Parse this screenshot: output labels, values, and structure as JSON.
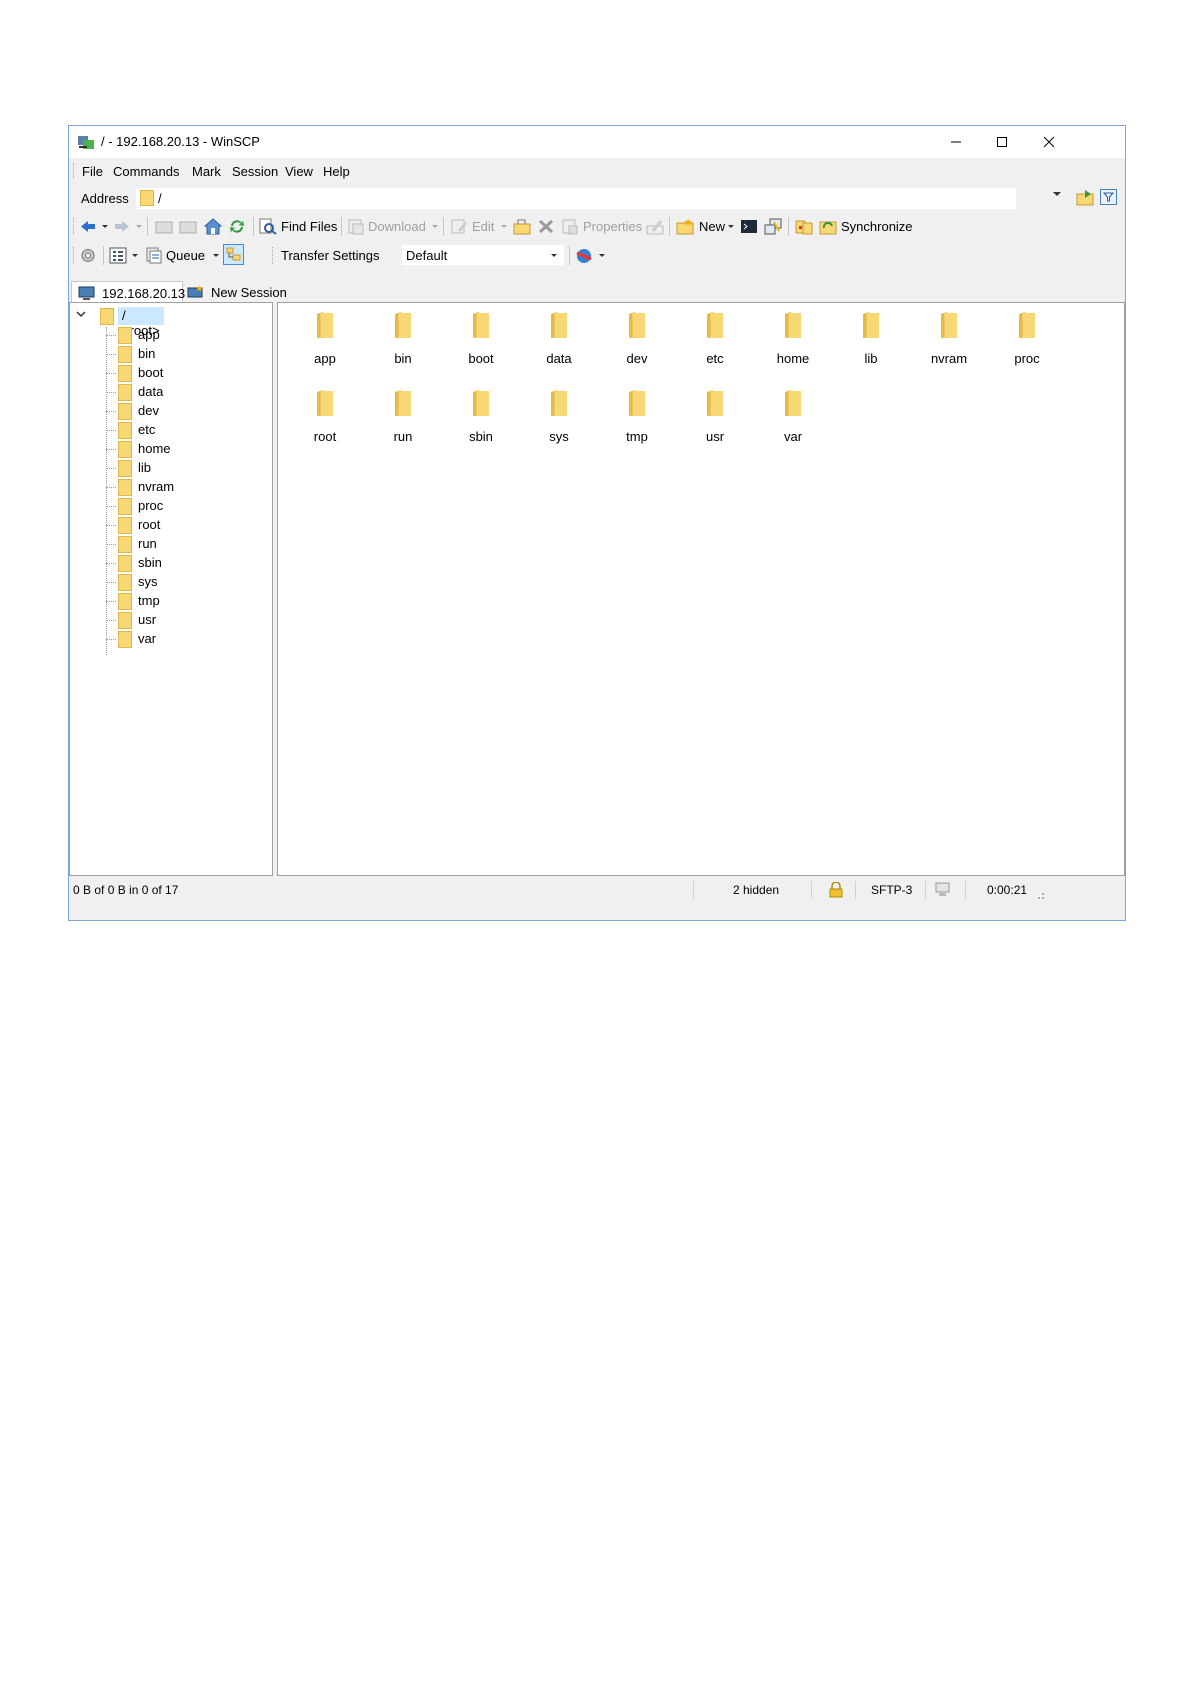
{
  "window": {
    "title": "/ - 192.168.20.13 - WinSCP"
  },
  "menu": [
    "File",
    "Commands",
    "Mark",
    "Session",
    "View",
    "Help"
  ],
  "address": {
    "label": "Address",
    "path": "/"
  },
  "toolbar1": {
    "find_files": "Find Files",
    "download": "Download",
    "edit": "Edit",
    "properties": "Properties",
    "new": "New",
    "synchronize": "Synchronize"
  },
  "toolbar2": {
    "queue": "Queue",
    "transfer_settings": "Transfer Settings",
    "transfer_value": "Default"
  },
  "tabs": {
    "session": "192.168.20.13",
    "new_session": "New Session"
  },
  "tree": {
    "root": "/ <root>",
    "items": [
      "app",
      "bin",
      "boot",
      "data",
      "dev",
      "etc",
      "home",
      "lib",
      "nvram",
      "proc",
      "root",
      "run",
      "sbin",
      "sys",
      "tmp",
      "usr",
      "var"
    ]
  },
  "files": [
    "app",
    "bin",
    "boot",
    "data",
    "dev",
    "etc",
    "home",
    "lib",
    "nvram",
    "proc",
    "root",
    "run",
    "sbin",
    "sys",
    "tmp",
    "usr",
    "var"
  ],
  "status": {
    "selection": "0 B of 0 B in 0 of 17",
    "hidden": "2 hidden",
    "protocol": "SFTP-3",
    "time": "0:00:21"
  },
  "colors": {
    "folder": "#f8d775",
    "folder_border": "#e0b84a",
    "window_border": "#7aa7d6",
    "selection": "#cce8ff"
  }
}
